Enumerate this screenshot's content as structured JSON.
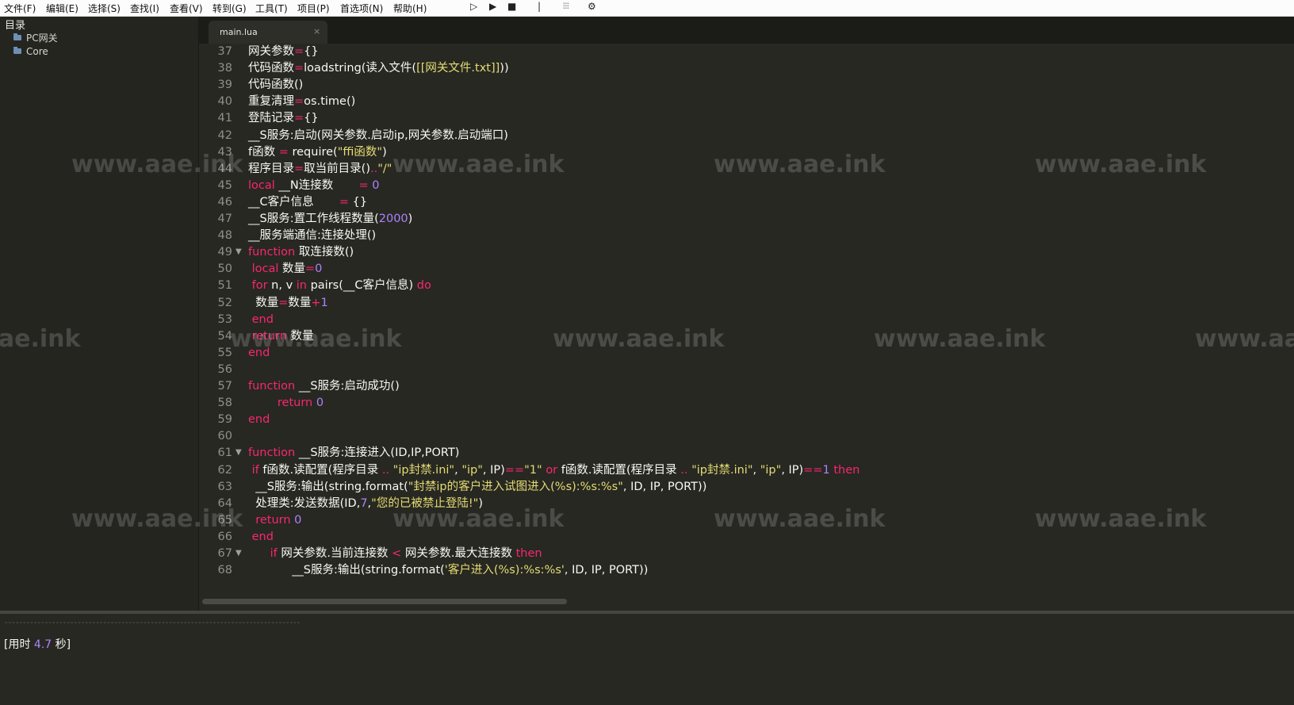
{
  "menu": {
    "file": "文件(F)",
    "edit": "编辑(E)",
    "select": "选择(S)",
    "find": "查找(I)",
    "view": "查看(V)",
    "goto": "转到(G)",
    "tools": "工具(T)",
    "project": "项目(P)",
    "prefs": "首选项(N)",
    "help": "帮助(H)"
  },
  "toolbar": {
    "run_outline": "▷",
    "run": "▶",
    "stop": "■",
    "separator": "|",
    "lines": "⫶⫶⫶",
    "settings": "⚙"
  },
  "sidebar": {
    "title": "目录",
    "items": [
      {
        "label": "PC网关"
      },
      {
        "label": "Core"
      }
    ]
  },
  "tab": {
    "label": "main.lua",
    "close": "×"
  },
  "code_lines": [
    {
      "num": "37",
      "text": "网关参数={}"
    },
    {
      "num": "38",
      "text": "代码函数=loadstring(读入文件([[网关文件.txt]]))"
    },
    {
      "num": "39",
      "text": "代码函数()"
    },
    {
      "num": "40",
      "text": "重复清理=os.time()"
    },
    {
      "num": "41",
      "text": "登陆记录={}"
    },
    {
      "num": "42",
      "text": "__S服务:启动(网关参数.启动ip,网关参数.启动端口)"
    },
    {
      "num": "43",
      "text": "f函数 = require(\"ffi函数\")"
    },
    {
      "num": "44",
      "text": "程序目录=取当前目录()..\"/\""
    },
    {
      "num": "45",
      "text": "local __N连接数       = 0"
    },
    {
      "num": "46",
      "text": "__C客户信息       = {}"
    },
    {
      "num": "47",
      "text": "__S服务:置工作线程数量(2000)"
    },
    {
      "num": "48",
      "text": "__服务端通信:连接处理()"
    },
    {
      "num": "49",
      "text": "function 取连接数()"
    },
    {
      "num": "50",
      "text": " local 数量=0"
    },
    {
      "num": "51",
      "text": " for n, v in pairs(__C客户信息) do"
    },
    {
      "num": "52",
      "text": "  数量=数量+1"
    },
    {
      "num": "53",
      "text": " end"
    },
    {
      "num": "54",
      "text": " return 数量"
    },
    {
      "num": "55",
      "text": "end"
    },
    {
      "num": "56",
      "text": ""
    },
    {
      "num": "57",
      "text": "function __S服务:启动成功()"
    },
    {
      "num": "58",
      "text": "        return 0"
    },
    {
      "num": "59",
      "text": "end"
    },
    {
      "num": "60",
      "text": ""
    },
    {
      "num": "61",
      "text": "function __S服务:连接进入(ID,IP,PORT)"
    },
    {
      "num": "62",
      "text": " if f函数.读配置(程序目录 .. \"ip封禁.ini\", \"ip\", IP)==\"1\" or f函数.读配置(程序目录 .. \"ip封禁.ini\", \"ip\", IP)==1 then"
    },
    {
      "num": "63",
      "text": "  __S服务:输出(string.format(\"封禁ip的客户进入试图进入(%s):%s:%s\", ID, IP, PORT))"
    },
    {
      "num": "64",
      "text": "  处理类:发送数据(ID,7,\"您的已被禁止登陆!\")"
    },
    {
      "num": "65",
      "text": "  return 0"
    },
    {
      "num": "66",
      "text": " end"
    },
    {
      "num": "67",
      "text": "      if 网关参数.当前连接数 < 网关参数.最大连接数 then"
    },
    {
      "num": "68",
      "text": "            __S服务:输出(string.format('客户进入(%s):%s:%s', ID, IP, PORT))"
    }
  ],
  "output": {
    "separator": "---------------------------------------------------------------------------------",
    "result": "[用时 4.7 秒]"
  },
  "watermark": "www.aae.ink"
}
